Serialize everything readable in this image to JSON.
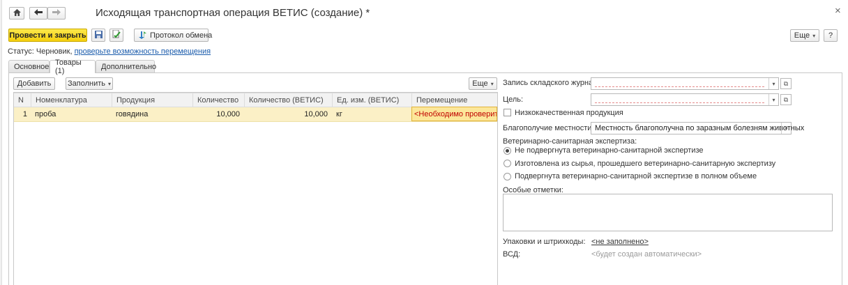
{
  "window": {
    "title": "Исходящая транспортная операция ВЕТИС (создание) *",
    "close_glyph": "×"
  },
  "icons": {
    "home": "home-icon",
    "back": "arrow-left-icon",
    "forward": "arrow-right-icon",
    "save": "floppy-disk-icon",
    "post": "document-post-icon",
    "exchange": "exchange-protocol-icon",
    "close": "close-icon",
    "dropdown": "chevron-down-icon",
    "open": "open-form-icon"
  },
  "toolbar": {
    "post_close_label": "Провести и закрыть",
    "protocol_label": "Протокол обмена",
    "more_label": "Еще",
    "help_label": "?"
  },
  "status": {
    "prefix": "Статус: Черновик,",
    "link": "проверьте возможность перемещения"
  },
  "tabs": [
    {
      "label": "Основное"
    },
    {
      "label": "Товары (1)"
    },
    {
      "label": "Дополнительно"
    }
  ],
  "grid_toolbar": {
    "add_label": "Добавить",
    "fill_label": "Заполнить",
    "more_label": "Еще"
  },
  "grid": {
    "columns": [
      "N",
      "Номенклатура",
      "Продукция",
      "Количество",
      "Количество (ВЕТИС)",
      "Ед. изм. (ВЕТИС)",
      "Перемещение"
    ],
    "rows": [
      [
        "1",
        "проба",
        "говядина",
        "10,000",
        "10,000",
        "кг",
        "<Необходимо проверить>"
      ]
    ]
  },
  "form": {
    "journal_label": "Запись складского журнала:",
    "purpose_label": "Цель:",
    "low_quality_label": "Низкокачественная продукция",
    "locality_label": "Благополучие местности:",
    "locality_value": "Местность благополучна по заразным болезням животных",
    "vet_exam_title": "Ветеринарно-санитарная экспертиза:",
    "vet_options": [
      "Не подвергнута ветеринарно-санитарной экспертизе",
      "Изготовлена из сырья, прошедшего ветеринарно-санитарную экспертизу",
      "Подвергнута ветеринарно-санитарной экспертизе в полном объеме"
    ],
    "vet_selected_index": 0,
    "notes_label": "Особые отметки:",
    "packages_label": "Упаковки и штрихкоды:",
    "packages_link": "<не заполнено>",
    "vsd_label": "ВСД:",
    "vsd_value": "<будет создан автоматически>"
  },
  "colors": {
    "primary_button": "#f5cf0e",
    "link": "#1a5bab",
    "selected_row": "#fbf0c6",
    "warning_text": "#c00000"
  }
}
